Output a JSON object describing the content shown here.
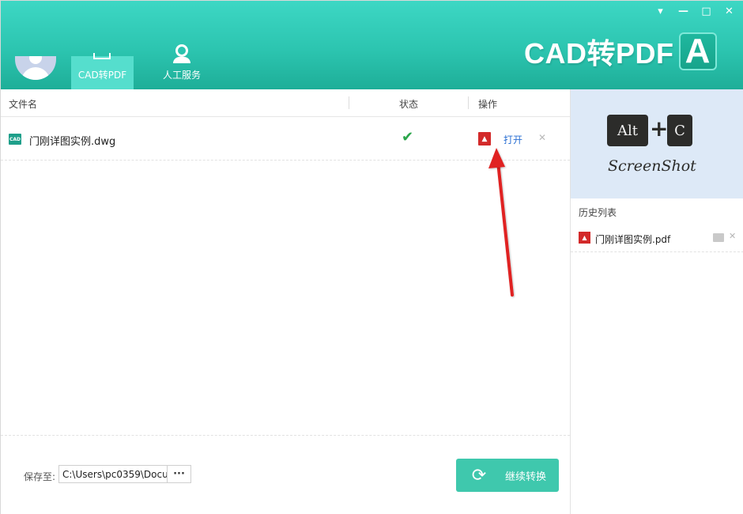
{
  "window": {
    "controls": {
      "menu": "▾",
      "minimize": "—",
      "maximize": "□",
      "close": "✕"
    }
  },
  "header": {
    "tabs": [
      {
        "label": "CAD转PDF",
        "active": true
      },
      {
        "label": "人工服务",
        "active": false
      }
    ],
    "logo_text": "CAD转PDF",
    "logo_badge": "A"
  },
  "table": {
    "columns": [
      "文件名",
      "状态",
      "操作"
    ],
    "rows": [
      {
        "icon_text": "CAD",
        "file_name": "门刚详图实例.dwg",
        "status_icon": "check-icon",
        "pdf_icon_text": "⬧",
        "action": "打开",
        "delete": "✕"
      }
    ]
  },
  "footer": {
    "save_label": "保存至:",
    "save_path": "C:\\Users\\pc0359\\Docu",
    "browse_label": "···",
    "convert_label": "继续转换",
    "convert_icon": "⟳"
  },
  "sidebar": {
    "banner": {
      "key1": "Alt",
      "plus": "+",
      "key2": "C",
      "caption": "ScreenShot"
    },
    "history_title": "历史列表",
    "history_items": [
      {
        "name": "门刚详图实例.pdf",
        "delete": "✕"
      }
    ]
  },
  "colors": {
    "header_top": "#3dd7c4",
    "header_bottom": "#1eae98",
    "accent": "#3fc8ad",
    "link": "#2a6fd3",
    "pdf_red": "#d32a2a",
    "arrow_red": "#e02020"
  }
}
